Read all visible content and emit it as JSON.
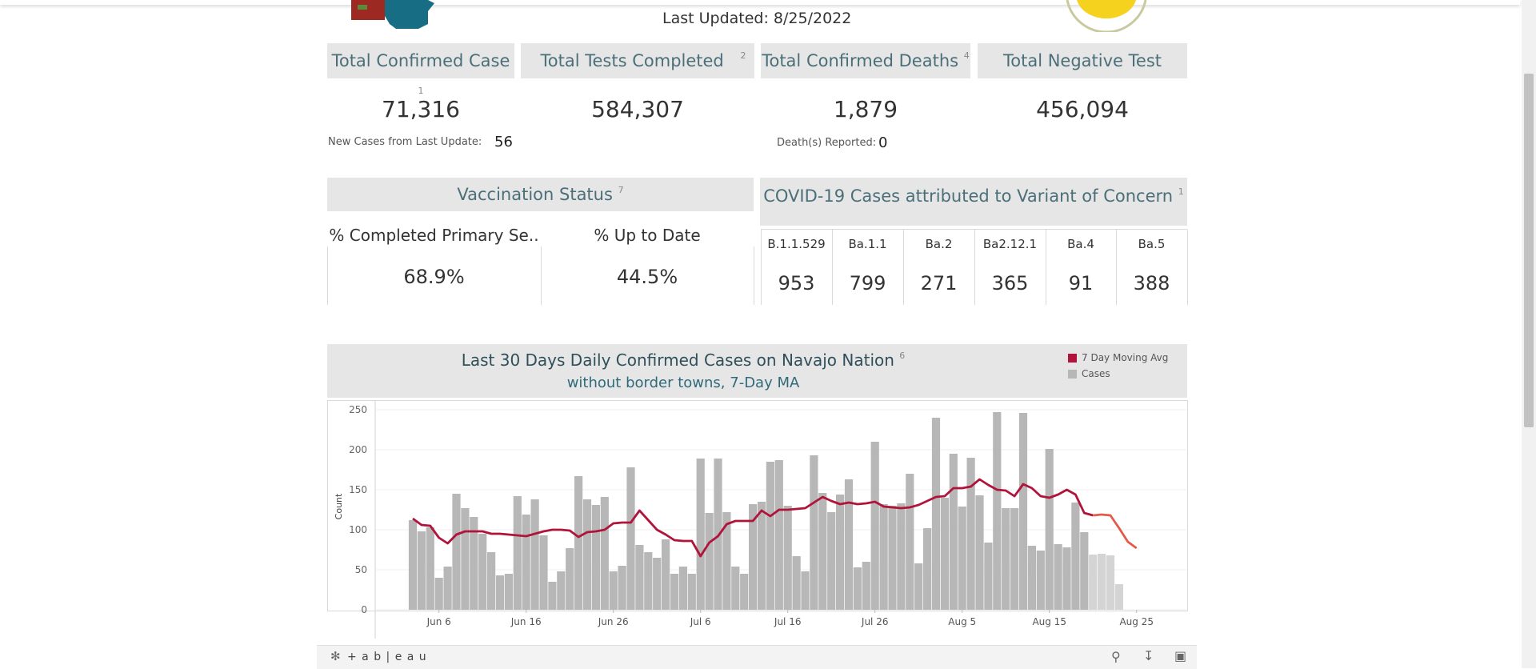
{
  "header": {
    "last_updated": "Last Updated: 8/25/2022"
  },
  "kpis": [
    {
      "label": "Total Confirmed Case",
      "note": "1",
      "value": "71,316",
      "sub_label": "New Cases from Last Update:",
      "sub_value": "56"
    },
    {
      "label": "Total Tests Completed",
      "note": "2",
      "value": "584,307",
      "sub_label": "",
      "sub_value": ""
    },
    {
      "label": "Total Confirmed Deaths",
      "note": "4",
      "value": "1,879",
      "sub_label": "Death(s) Reported:",
      "sub_value": "0"
    },
    {
      "label": "Total Negative Test",
      "note": "",
      "value": "456,094",
      "sub_label": "",
      "sub_value": ""
    }
  ],
  "vaccination": {
    "title": "Vaccination Status",
    "note": "7",
    "columns": [
      {
        "label": "% Completed Primary Se..",
        "value": "68.9%"
      },
      {
        "label": "% Up to Date",
        "value": "44.5%"
      }
    ]
  },
  "variants": {
    "title": "COVID-19 Cases attributed to Variant of Concern",
    "note": "1",
    "columns": [
      {
        "label": "B.1.1.529",
        "value": "953"
      },
      {
        "label": "Ba.1.1",
        "value": "799"
      },
      {
        "label": "Ba.2",
        "value": "271"
      },
      {
        "label": "Ba2.12.1",
        "value": "365"
      },
      {
        "label": "Ba.4",
        "value": "91"
      },
      {
        "label": "Ba.5",
        "value": "388"
      }
    ]
  },
  "footer": {
    "brand": "+ a b | e a u"
  },
  "colors": {
    "ma": "#b0143a",
    "ma_recent": "#e45a4a",
    "bars": "#b7b7b7",
    "bars_recent": "#d4d4d4",
    "header_text": "#4b6f79"
  },
  "chart_data": {
    "type": "bar",
    "title": "Last 30 Days Daily Confirmed Cases on Navajo Nation",
    "title_note": "6",
    "subtitle": "without border towns, 7-Day MA",
    "xlabel": "",
    "ylabel": "Count",
    "ylim": [
      0,
      250
    ],
    "yticks": [
      0,
      50,
      100,
      150,
      200,
      250
    ],
    "xticks": [
      {
        "label": "Jun 6",
        "day": 7
      },
      {
        "label": "Jun 16",
        "day": 17
      },
      {
        "label": "Jun 26",
        "day": 27
      },
      {
        "label": "Jul 6",
        "day": 37
      },
      {
        "label": "Jul 16",
        "day": 47
      },
      {
        "label": "Jul 26",
        "day": 57
      },
      {
        "label": "Aug 5",
        "day": 67
      },
      {
        "label": "Aug 15",
        "day": 77
      },
      {
        "label": "Aug 25",
        "day": 87
      }
    ],
    "legend": [
      "7 Day Moving Avg",
      "Cases"
    ],
    "legend_position": "top-right",
    "grid": true,
    "recent_start_index": 78,
    "series": [
      {
        "name": "Cases",
        "values": [
          112,
          98,
          103,
          40,
          54,
          145,
          127,
          116,
          95,
          72,
          43,
          45,
          142,
          119,
          138,
          93,
          35,
          48,
          77,
          167,
          138,
          131,
          141,
          48,
          55,
          178,
          81,
          72,
          65,
          88,
          45,
          54,
          45,
          189,
          121,
          189,
          122,
          54,
          45,
          132,
          135,
          185,
          187,
          130,
          67,
          48,
          193,
          146,
          122,
          144,
          163,
          53,
          60,
          210,
          132,
          130,
          133,
          170,
          58,
          102,
          240,
          140,
          195,
          129,
          190,
          143,
          84,
          247,
          127,
          127,
          246,
          80,
          74,
          201,
          82,
          78,
          134,
          97,
          69,
          70,
          68,
          32
        ]
      },
      {
        "name": "7 Day Moving Avg",
        "values": [
          114,
          106,
          105,
          90,
          83,
          94,
          98,
          98,
          98,
          95,
          95,
          94,
          93,
          92,
          95,
          98,
          100,
          100,
          99,
          91,
          97,
          98,
          100,
          108,
          109,
          109,
          124,
          112,
          100,
          94,
          87,
          86,
          86,
          67,
          84,
          92,
          107,
          111,
          111,
          111,
          124,
          117,
          125,
          125,
          126,
          127,
          134,
          141,
          136,
          132,
          134,
          132,
          133,
          135,
          129,
          128,
          127,
          128,
          131,
          136,
          141,
          142,
          152,
          152,
          154,
          163,
          156,
          150,
          149,
          142,
          157,
          152,
          142,
          140,
          144,
          150,
          144,
          121,
          118,
          119,
          118,
          102,
          85,
          77
        ]
      }
    ]
  }
}
